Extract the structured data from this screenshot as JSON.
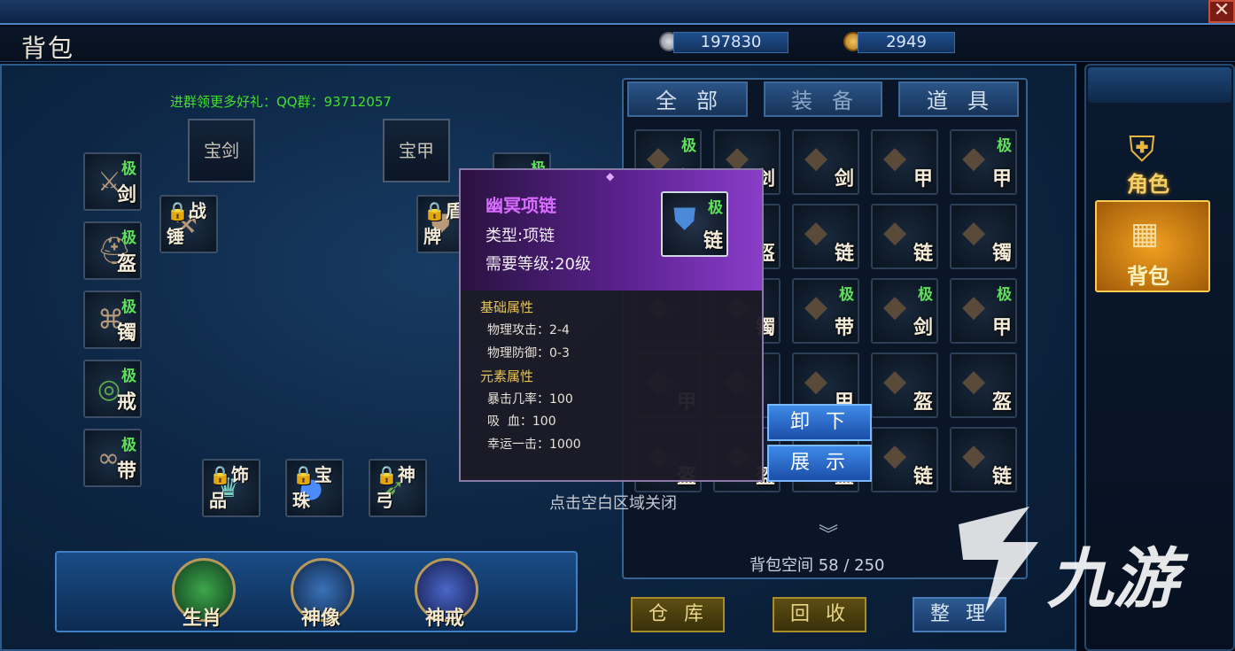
{
  "header": {
    "title": "背包",
    "close_label": "✕",
    "silver": "197830",
    "gold": "2949"
  },
  "promo": "进群领更多好礼：QQ群：93712057",
  "equip": {
    "top_labels": [
      "宝剑",
      "宝甲"
    ],
    "left_slots": [
      {
        "tier": "极",
        "label": "剑",
        "icon": "sword-icon"
      },
      {
        "tier": "极",
        "label": "盔",
        "icon": "helmet-icon"
      },
      {
        "tier": "极",
        "label": "镯",
        "icon": "bracer-icon"
      },
      {
        "tier": "极",
        "label": "戒",
        "icon": "ring-icon"
      },
      {
        "tier": "极",
        "label": "带",
        "icon": "belt-icon"
      }
    ],
    "locked": [
      "战锤",
      "盾牌",
      "饰品",
      "宝珠",
      "神弓"
    ],
    "shield_tier": "极"
  },
  "tabs": [
    "全部",
    "装备",
    "道具"
  ],
  "grid": [
    [
      {
        "t": "极",
        "l": "剑"
      },
      {
        "t": "",
        "l": "剑"
      },
      {
        "t": "",
        "l": "剑"
      },
      {
        "t": "",
        "l": "甲"
      },
      {
        "t": "极",
        "l": "甲"
      }
    ],
    [
      {
        "t": "",
        "l": ""
      },
      {
        "t": "",
        "l": "盔"
      },
      {
        "t": "",
        "l": "链"
      },
      {
        "t": "",
        "l": "链"
      },
      {
        "t": "",
        "l": "镯"
      }
    ],
    [
      {
        "t": "",
        "l": ""
      },
      {
        "t": "",
        "l": "镯"
      },
      {
        "t": "极",
        "l": "带"
      },
      {
        "t": "极",
        "l": "剑"
      },
      {
        "t": "极",
        "l": "甲"
      }
    ],
    [
      {
        "t": "",
        "l": "甲"
      },
      {
        "t": "",
        "l": ""
      },
      {
        "t": "",
        "l": "甲"
      },
      {
        "t": "",
        "l": "盔"
      },
      {
        "t": "",
        "l": "盔"
      }
    ],
    [
      {
        "t": "",
        "l": "盔"
      },
      {
        "t": "",
        "l": "盔"
      },
      {
        "t": "",
        "l": "盔"
      },
      {
        "t": "",
        "l": "链"
      },
      {
        "t": "",
        "l": "链"
      }
    ]
  ],
  "tooltip": {
    "name": "幽冥项链",
    "type": "类型:项链",
    "level": "需要等级:20级",
    "tier": "极",
    "slot": "链",
    "base_head": "基础属性",
    "base": [
      "物理攻击：2-4",
      "物理防御：0-3"
    ],
    "elem_head": "元素属性",
    "elem": [
      "暴击几率：100",
      "吸  血：100",
      "幸运一击：1000"
    ]
  },
  "actions": {
    "unequip": "卸下",
    "show": "展示"
  },
  "hint": "点击空白区域关闭",
  "capacity": "背包空间  58  /  250",
  "bottom_buttons": [
    "仓库",
    "回收",
    "整理"
  ],
  "medals": [
    "生肖",
    "神像",
    "神戒"
  ],
  "rightnav": [
    "角色",
    "背包"
  ],
  "watermark": "九游"
}
